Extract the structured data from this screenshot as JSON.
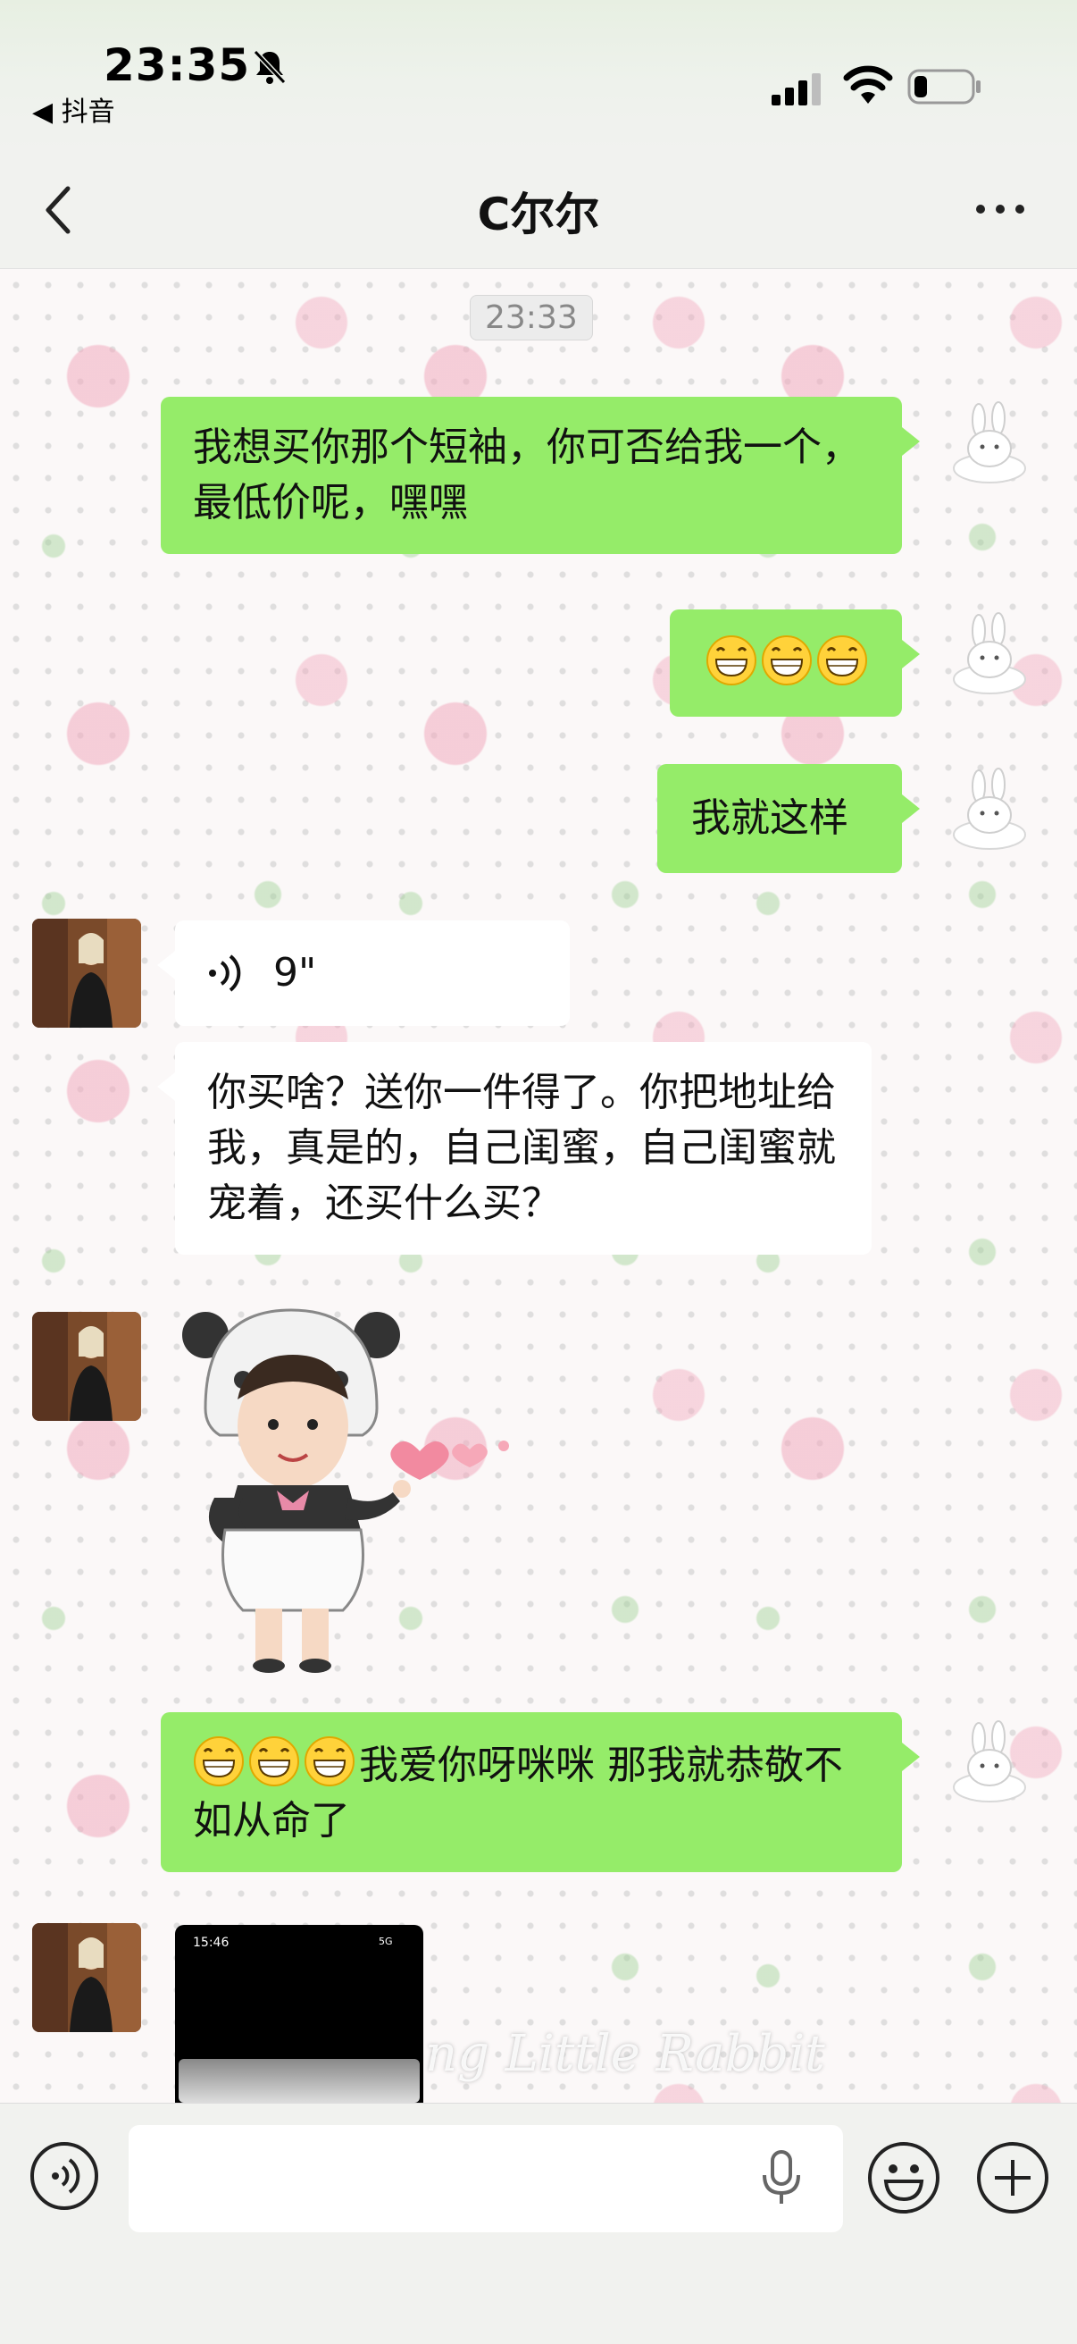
{
  "status_bar": {
    "time": "23:35",
    "back_app": "◀ 抖音"
  },
  "header": {
    "title": "C尔尔"
  },
  "chat": {
    "timestamp": "23:33",
    "messages": [
      {
        "dir": "out",
        "text": "我想买你那个短袖，你可否给我一个，最低价呢，嘿嘿"
      },
      {
        "dir": "out",
        "emoji_count": 3,
        "emoji": "grinning-face-emoji"
      },
      {
        "dir": "out",
        "text": "我就这样"
      },
      {
        "dir": "in",
        "voice_duration": "9\""
      },
      {
        "dir": "in",
        "text": "你买啥？送你一件得了。你把地址给我，真是的，自己闺蜜，自己闺蜜就宠着，还买什么买？"
      },
      {
        "dir": "in",
        "sticker": "panda-girl-heart-sticker"
      },
      {
        "dir": "out",
        "text": "我爱你呀咪咪 那我就恭敬不如从命了",
        "emoji_count": 3
      },
      {
        "dir": "in",
        "image_time": "15:46",
        "image_net": "5G"
      }
    ],
    "watermark": "ng Little Rabbit"
  },
  "colors": {
    "out_bubble": "#95ec69",
    "in_bubble": "#ffffff",
    "bg": "#fbf8f8"
  }
}
